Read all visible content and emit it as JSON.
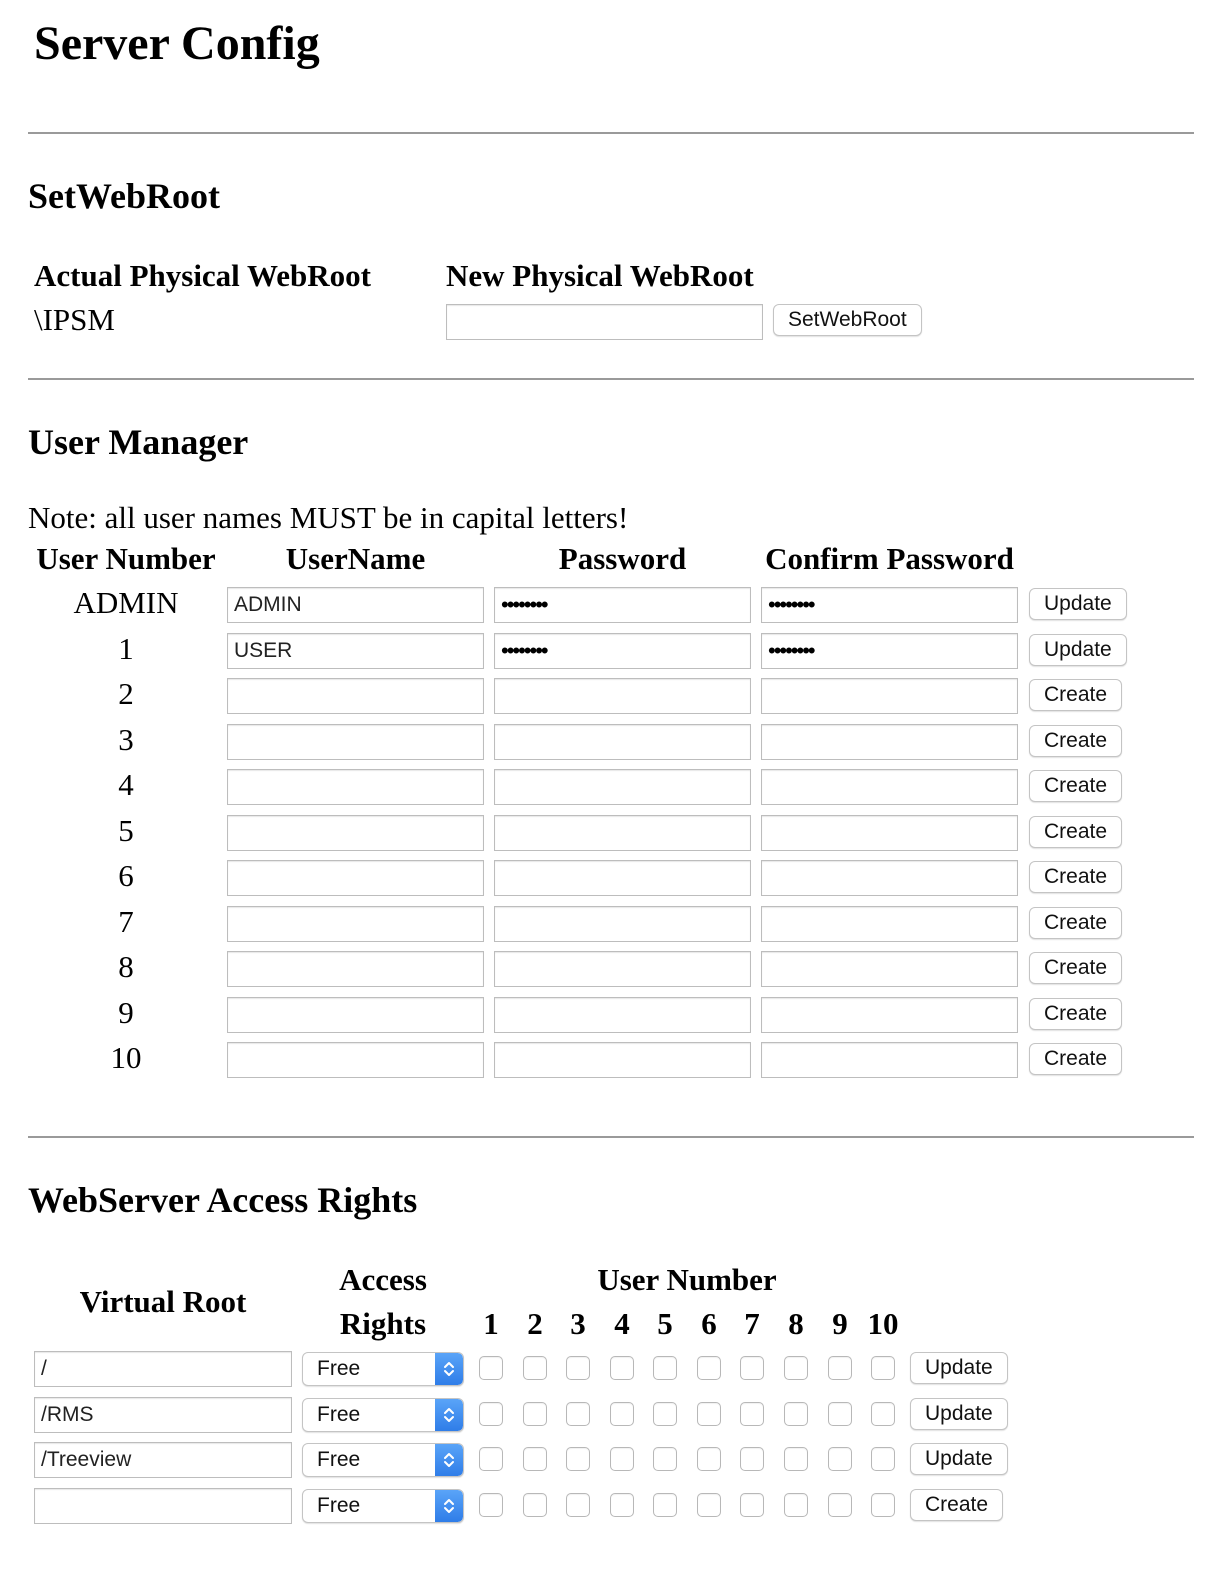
{
  "page": {
    "title": "Server Config"
  },
  "webroot": {
    "heading": "SetWebRoot",
    "actual_label": "Actual Physical WebRoot",
    "actual_value": "\\IPSM",
    "new_label": "New Physical WebRoot",
    "new_value": "",
    "button": "SetWebRoot"
  },
  "users": {
    "heading": "User Manager",
    "note": "Note: all user names MUST be in capital letters!",
    "columns": [
      "User Number",
      "UserName",
      "Password",
      "Confirm Password"
    ],
    "rows": [
      {
        "number": "ADMIN",
        "username": "ADMIN",
        "password": "••••••••",
        "confirm": "••••••••",
        "action": "Update"
      },
      {
        "number": "1",
        "username": "USER",
        "password": "••••••••",
        "confirm": "••••••••",
        "action": "Update"
      },
      {
        "number": "2",
        "username": "",
        "password": "",
        "confirm": "",
        "action": "Create"
      },
      {
        "number": "3",
        "username": "",
        "password": "",
        "confirm": "",
        "action": "Create"
      },
      {
        "number": "4",
        "username": "",
        "password": "",
        "confirm": "",
        "action": "Create"
      },
      {
        "number": "5",
        "username": "",
        "password": "",
        "confirm": "",
        "action": "Create"
      },
      {
        "number": "6",
        "username": "",
        "password": "",
        "confirm": "",
        "action": "Create"
      },
      {
        "number": "7",
        "username": "",
        "password": "",
        "confirm": "",
        "action": "Create"
      },
      {
        "number": "8",
        "username": "",
        "password": "",
        "confirm": "",
        "action": "Create"
      },
      {
        "number": "9",
        "username": "",
        "password": "",
        "confirm": "",
        "action": "Create"
      },
      {
        "number": "10",
        "username": "",
        "password": "",
        "confirm": "",
        "action": "Create"
      }
    ]
  },
  "access": {
    "heading": "WebServer Access Rights",
    "col_virtual_root": "Virtual Root",
    "col_access_line1": "Access",
    "col_access_line2": "Rights",
    "col_user_number": "User Number",
    "user_numbers": [
      "1",
      "2",
      "3",
      "4",
      "5",
      "6",
      "7",
      "8",
      "9",
      "10"
    ],
    "rows": [
      {
        "root": "/",
        "rights": "Free",
        "checked": [
          false,
          false,
          false,
          false,
          false,
          false,
          false,
          false,
          false,
          false
        ],
        "action": "Update"
      },
      {
        "root": "/RMS",
        "rights": "Free",
        "checked": [
          false,
          false,
          false,
          false,
          false,
          false,
          false,
          false,
          false,
          false
        ],
        "action": "Update"
      },
      {
        "root": "/Treeview",
        "rights": "Free",
        "checked": [
          false,
          false,
          false,
          false,
          false,
          false,
          false,
          false,
          false,
          false
        ],
        "action": "Update"
      },
      {
        "root": "",
        "rights": "Free",
        "checked": [
          false,
          false,
          false,
          false,
          false,
          false,
          false,
          false,
          false,
          false
        ],
        "action": "Create"
      }
    ]
  }
}
